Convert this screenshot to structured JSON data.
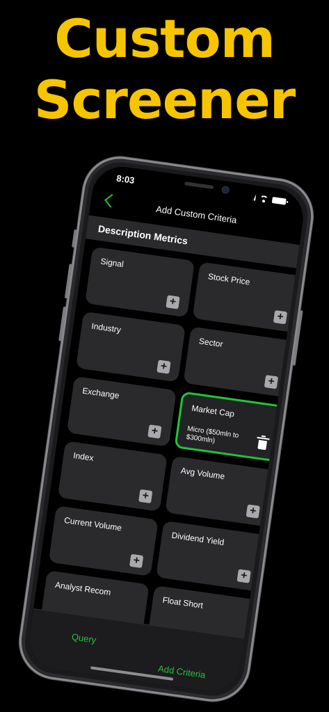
{
  "headline": {
    "line1": "Custom",
    "line2": "Screener"
  },
  "status_bar": {
    "time": "8:03"
  },
  "navbar": {
    "title": "Add Custom Criteria"
  },
  "section": {
    "title": "Description Metrics"
  },
  "criteria": [
    {
      "label": "Signal"
    },
    {
      "label": "Stock Price"
    },
    {
      "label": "Industry"
    },
    {
      "label": "Sector"
    },
    {
      "label": "Exchange"
    },
    {
      "label": "Market Cap",
      "value": "Micro ($50mln to $300mln)",
      "selected": true
    },
    {
      "label": "Index"
    },
    {
      "label": "Avg Volume"
    },
    {
      "label": "Current Volume"
    },
    {
      "label": "Dividend Yield"
    },
    {
      "label": "Analyst Recom"
    },
    {
      "label": "Float Short"
    }
  ],
  "add_symbol": "+",
  "tabs": {
    "query": "Query",
    "add_criteria": "Add Criteria"
  },
  "colors": {
    "accent": "#22c33a",
    "headline": "#f7c400",
    "card": "#2a2a2c"
  }
}
